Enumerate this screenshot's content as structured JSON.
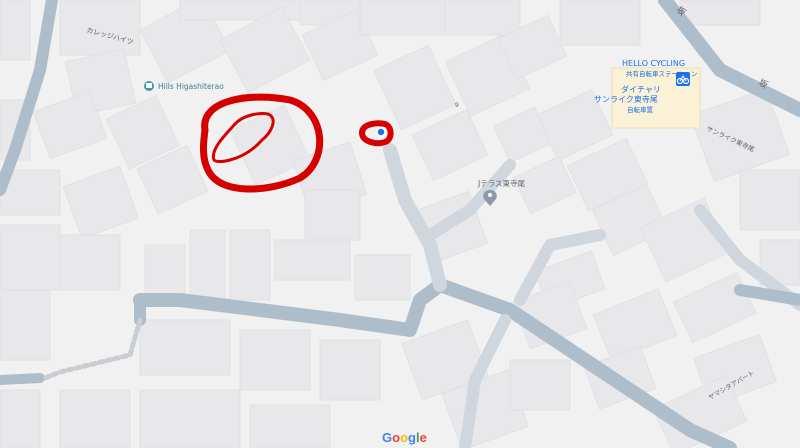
{
  "map": {
    "labels": {
      "building_karegg": "カレッジハイツ",
      "hills": "Hills Higashiterao",
      "jterrace": "Jテラス東寺尾",
      "suntrike": "サンライク東寺尾",
      "yamashita": "ヤマシタアパート",
      "block_number": "9"
    },
    "roads": {
      "upper_right_slope": "坂",
      "right_slope": "坂"
    },
    "business": {
      "brand": "HELLO CYCLING",
      "sub1": "共有自転車ステーション",
      "name1": "ダイチャリ",
      "name2": "サンライク東寺尾",
      "name3": "自転車置"
    },
    "attribution": {
      "google_letters": [
        "G",
        "o",
        "o",
        "g",
        "l",
        "e"
      ],
      "google_colors": [
        "#4285F4",
        "#EA4335",
        "#FBBC05",
        "#4285F4",
        "#34A853",
        "#EA4335"
      ]
    },
    "colors": {
      "background": "#f1f1f2",
      "building": "#e8e8ea",
      "building_stroke": "#dadce0",
      "road": "#aebdca",
      "road_outline": "#9fb0bf",
      "annotation": "#d50000",
      "poi_teal": "#3c9ab2",
      "biz_yellow": "#fbf1d6",
      "biz_text": "#1a73e8"
    },
    "icons": [
      "hotel-pin-icon",
      "location-pin-icon",
      "bicycle-station-icon",
      "blue-dot-icon"
    ]
  }
}
